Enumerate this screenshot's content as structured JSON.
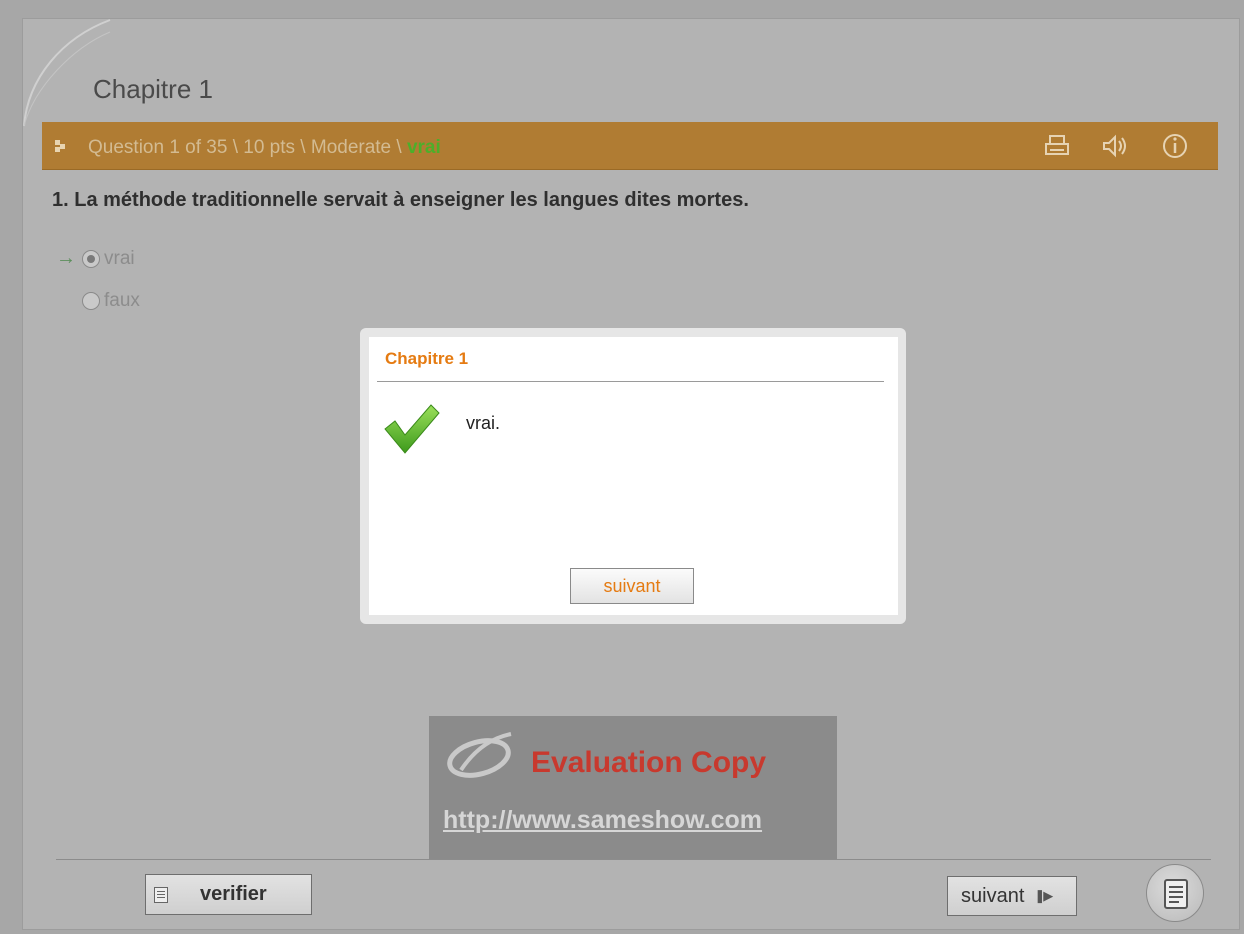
{
  "chapter": {
    "title": "Chapitre 1"
  },
  "question_bar": {
    "info": "Question 1 of 35 \\ 10 pts \\ Moderate \\ ",
    "status": "vrai",
    "icons": [
      "print-icon",
      "speaker-icon",
      "info-icon"
    ]
  },
  "question": {
    "text": "1.  La méthode traditionnelle servait à enseigner les langues dites mortes."
  },
  "options": [
    {
      "label": "vrai",
      "selected": true
    },
    {
      "label": "faux",
      "selected": false
    }
  ],
  "modal": {
    "title": "Chapitre 1",
    "message": "vrai.",
    "button": "suivant"
  },
  "watermark": {
    "text": "Evaluation Copy",
    "url": "http://www.sameshow.com"
  },
  "footer": {
    "verify_label": "verifier",
    "next_label": "suivant"
  },
  "colors": {
    "accent_bar": "#b07c33",
    "modal_title": "#e57b12",
    "status_green": "#4caf2a",
    "watermark_red": "#c8392e"
  }
}
